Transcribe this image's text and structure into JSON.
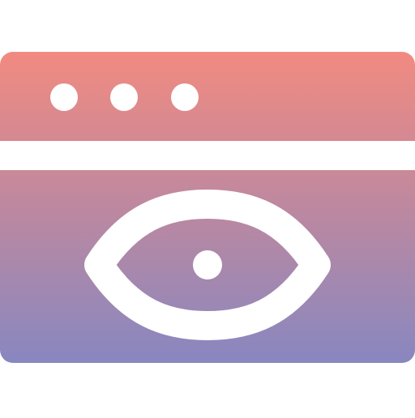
{
  "icon": {
    "name": "browser-window-view-icon",
    "gradient": {
      "top_color": "#F28A80",
      "bottom_color": "#8887C0"
    },
    "background_color": "#FFFFFF",
    "cutout_color": "#FFFFFF"
  }
}
